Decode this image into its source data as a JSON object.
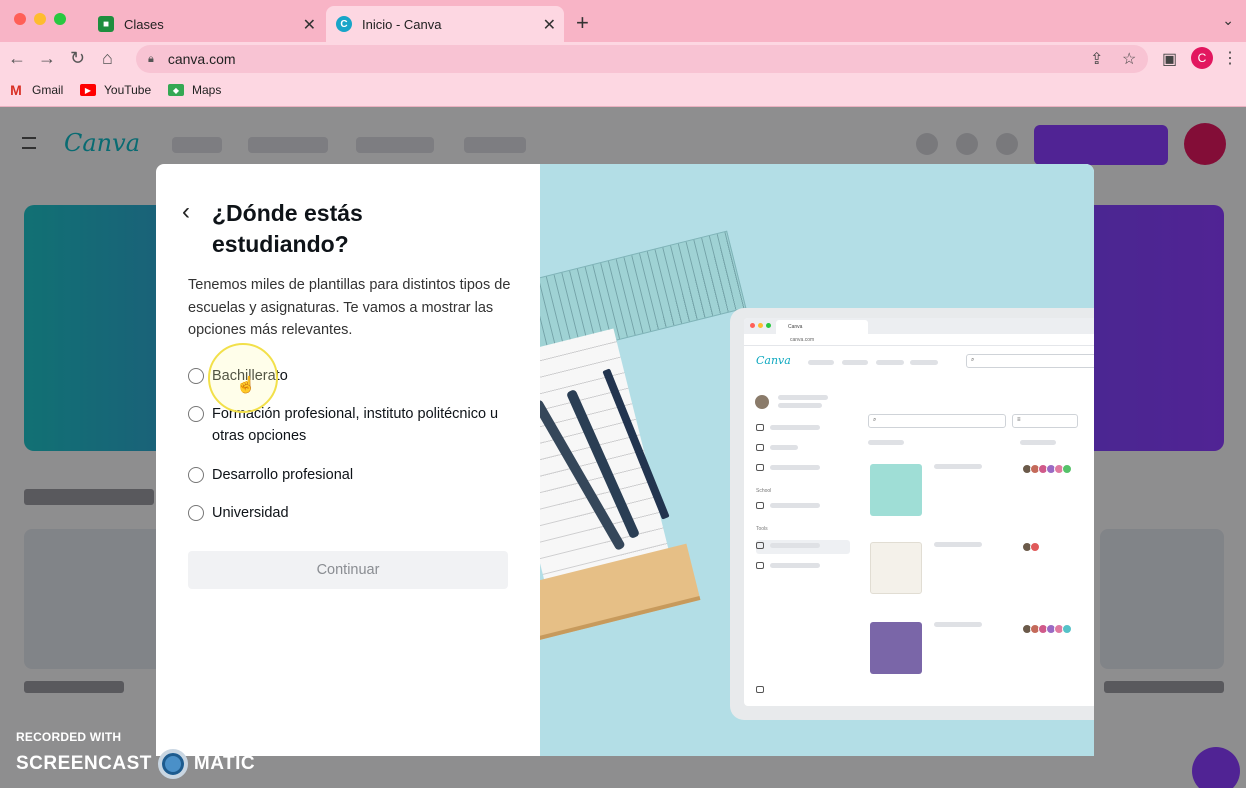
{
  "browser": {
    "tabs": [
      {
        "title": "Clases",
        "active": false
      },
      {
        "title": "Inicio - Canva",
        "active": true
      }
    ],
    "url": "canva.com",
    "profile_initial": "C",
    "bookmarks": [
      "Gmail",
      "YouTube",
      "Maps"
    ]
  },
  "modal": {
    "title": "¿Dónde estás estudiando?",
    "description": "Tenemos miles de plantillas para distintos tipos de escuelas y asignaturas. Te vamos a mostrar las opciones más relevantes.",
    "options": [
      "Bachillerato",
      "Formación profesional, instituto politécnico u otras opciones",
      "Desarrollo profesional",
      "Universidad"
    ],
    "continue_label": "Continuar"
  },
  "illustration": {
    "tab_title": "Canva",
    "url": "canva.com",
    "logo": "Canva",
    "section_school": "School",
    "section_tools": "Tools"
  },
  "watermark": {
    "line1": "RECORDED WITH",
    "word1": "SCREENCAST",
    "word2": "MATIC"
  },
  "colors": {
    "chrome_tab": "#f8b4c6",
    "canva_purple": "#8b3dff",
    "canva_teal": "#10b8c4",
    "illustration_bg": "#b3dee6"
  }
}
